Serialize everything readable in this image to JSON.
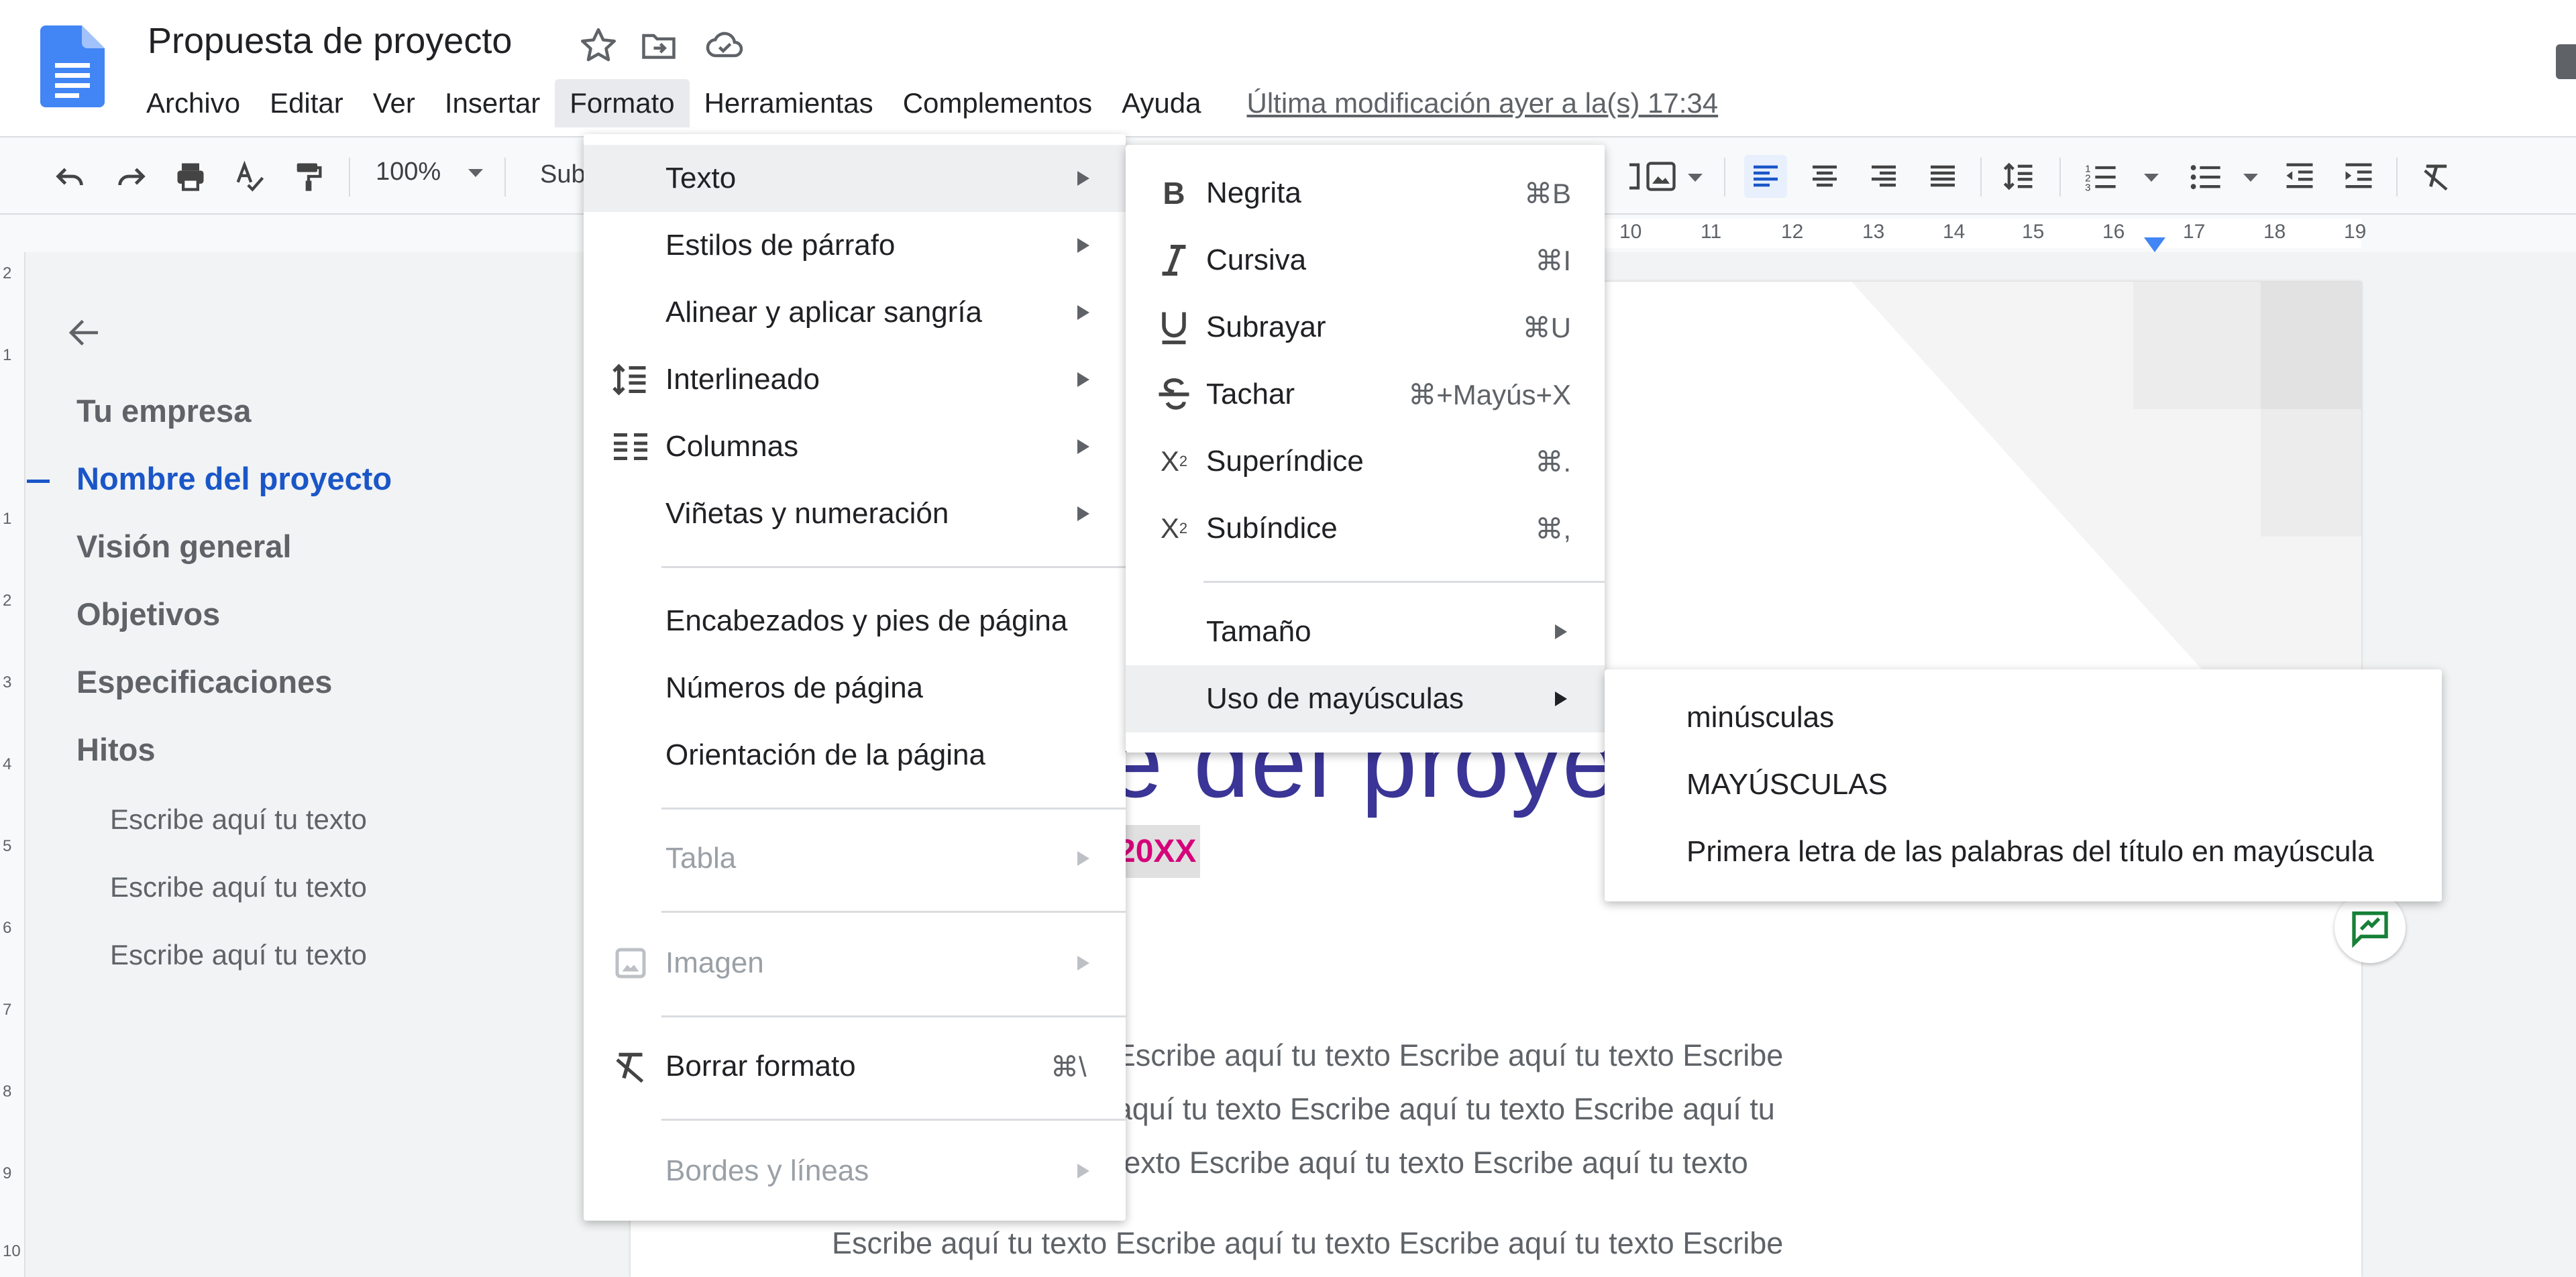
{
  "titlebar": {
    "doc_title": "Propuesta de proyecto",
    "menu": [
      "Archivo",
      "Editar",
      "Ver",
      "Insertar",
      "Formato",
      "Herramientas",
      "Complementos",
      "Ayuda"
    ],
    "active_menu": "Formato",
    "last_modified": "Última modificación ayer a la(s) 17:34",
    "icons": [
      "star-icon",
      "move-to-folder-icon",
      "cloud-saved-icon"
    ]
  },
  "toolbar": {
    "zoom": "100%",
    "style_select": "Sub",
    "icons": [
      "undo-icon",
      "redo-icon",
      "print-icon",
      "spellcheck-icon",
      "paint-format-icon",
      "insert-image-icon",
      "align-left-icon",
      "align-center-icon",
      "align-right-icon",
      "justify-icon",
      "line-spacing-icon",
      "numbered-list-icon",
      "bulleted-list-icon",
      "decrease-indent-icon",
      "increase-indent-icon",
      "clear-formatting-icon"
    ]
  },
  "ruler": {
    "numbers": [
      "10",
      "11",
      "12",
      "13",
      "14",
      "15",
      "16",
      "17",
      "18",
      "19"
    ]
  },
  "vruler": {
    "numbers": [
      "2",
      "1",
      "1",
      "2",
      "3",
      "4",
      "5",
      "6",
      "7",
      "8",
      "9",
      "10"
    ]
  },
  "outline": {
    "headings": [
      {
        "label": "Tu empresa",
        "active": false
      },
      {
        "label": "Nombre del proyecto",
        "active": true
      },
      {
        "label": "Visión general",
        "active": false
      },
      {
        "label": "Objetivos",
        "active": false
      },
      {
        "label": "Especificaciones",
        "active": false
      },
      {
        "label": "Hitos",
        "active": false
      }
    ],
    "subitems": [
      "Escribe aquí tu texto",
      "Escribe aquí tu texto",
      "Escribe aquí tu texto"
    ]
  },
  "page": {
    "title_fragment": "e del proyec",
    "date_fragment": "20XX",
    "lines": [
      "Escribe aquí tu texto Escribe aquí tu texto Escribe aquí tu texto Escribe",
      "aquí tu texto Escribe aquí tu texto Escribe aquí tu texto Escribe aquí tu",
      "texto Escribe aquí tu texto Escribe aquí tu texto Escribe aquí tu texto",
      "Escribe aquí tu texto Escribe aquí tu texto Escribe aquí tu texto Escribe"
    ]
  },
  "formato_menu": {
    "items": [
      {
        "label": "Texto",
        "submenu": true,
        "highlighted": true,
        "icon": ""
      },
      {
        "label": "Estilos de párrafo",
        "submenu": true,
        "icon": ""
      },
      {
        "label": "Alinear y aplicar sangría",
        "submenu": true,
        "icon": ""
      },
      {
        "label": "Interlineado",
        "submenu": true,
        "icon": "line-spacing-icon"
      },
      {
        "label": "Columnas",
        "submenu": true,
        "icon": "columns-icon"
      },
      {
        "label": "Viñetas y numeración",
        "submenu": true,
        "icon": ""
      },
      {
        "label": "Encabezados y pies de página",
        "submenu": false,
        "icon": ""
      },
      {
        "label": "Números de página",
        "submenu": false,
        "icon": ""
      },
      {
        "label": "Orientación de la página",
        "submenu": false,
        "icon": ""
      },
      {
        "label": "Tabla",
        "submenu": true,
        "disabled": true,
        "icon": ""
      },
      {
        "label": "Imagen",
        "submenu": true,
        "disabled": true,
        "icon": "image-icon"
      },
      {
        "label": "Borrar formato",
        "submenu": false,
        "shortcut": "⌘\\",
        "icon": "clear-formatting-icon"
      },
      {
        "label": "Bordes y líneas",
        "submenu": true,
        "disabled": true,
        "icon": ""
      }
    ]
  },
  "texto_menu": {
    "items": [
      {
        "label": "Negrita",
        "shortcut": "⌘B",
        "icon": "bold-icon"
      },
      {
        "label": "Cursiva",
        "shortcut": "⌘I",
        "icon": "italic-icon"
      },
      {
        "label": "Subrayar",
        "shortcut": "⌘U",
        "icon": "underline-icon"
      },
      {
        "label": "Tachar",
        "shortcut": "⌘+Mayús+X",
        "icon": "strikethrough-icon"
      },
      {
        "label": "Superíndice",
        "shortcut": "⌘.",
        "icon": "superscript-icon"
      },
      {
        "label": "Subíndice",
        "shortcut": "⌘,",
        "icon": "subscript-icon"
      },
      {
        "label": "Tamaño",
        "submenu": true
      },
      {
        "label": "Uso de mayúsculas",
        "submenu": true,
        "highlighted": true
      }
    ]
  },
  "mayusculas_menu": {
    "items": [
      "minúsculas",
      "MAYÚSCULAS",
      "Primera letra de las palabras del título en mayúscula"
    ]
  }
}
